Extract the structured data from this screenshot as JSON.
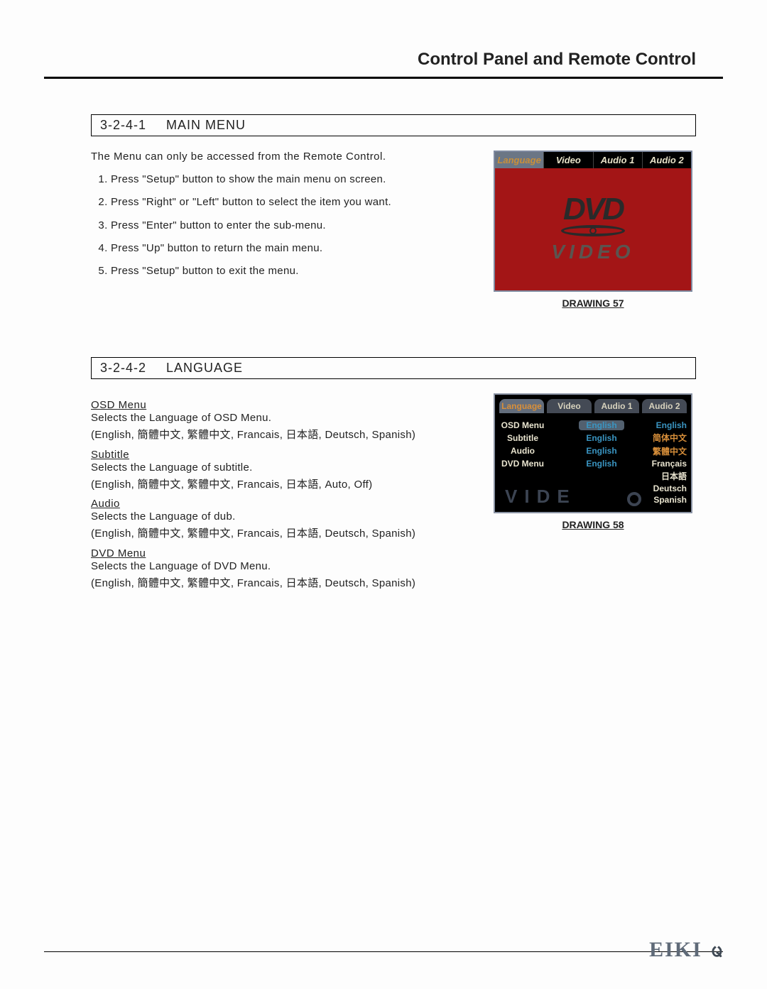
{
  "header": {
    "title": "Control Panel and Remote Control"
  },
  "section1": {
    "num": "3-2-4-1",
    "title": "MAIN MENU",
    "intro": "The Menu can only be accessed from the Remote Control.",
    "steps": [
      "Press \"Setup\" button to show the main menu on screen.",
      "Press \"Right\" or \"Left\" button to select the item you want.",
      "Press \"Enter\" button to enter the sub-menu.",
      "Press \"Up\" button to return the main menu.",
      "Press \"Setup\" button to exit the menu."
    ],
    "figure": {
      "tabs": [
        "Language",
        "Video",
        "Audio 1",
        "Audio 2"
      ],
      "logo_top": "DVD",
      "logo_bottom": "VIDEO",
      "caption": "DRAWING 57"
    }
  },
  "section2": {
    "num": "3-2-4-2",
    "title": "LANGUAGE",
    "items": [
      {
        "h": "OSD Menu",
        "d1": "Selects the Language of OSD Menu.",
        "d2": "(English, 簡體中文, 繁體中文, Francais, 日本語, Deutsch, Spanish)"
      },
      {
        "h": "Subtitle",
        "d1": "Selects the Language of subtitle.",
        "d2": "(English, 簡體中文, 繁體中文, Francais, 日本語, Auto, Off)"
      },
      {
        "h": "Audio",
        "d1": "Selects the Language of dub.",
        "d2": "(English, 簡體中文, 繁體中文, Francais, 日本語, Deutsch, Spanish)"
      },
      {
        "h": "DVD Menu",
        "d1": "Selects the Language of DVD Menu.",
        "d2": "(English, 簡體中文, 繁體中文, Francais, 日本語, Deutsch, Spanish)"
      }
    ],
    "figure": {
      "tabs": [
        "Language",
        "Video",
        "Audio 1",
        "Audio 2"
      ],
      "rows": {
        "labels": [
          "OSD Menu",
          "Subtitle",
          "Audio",
          "DVD Menu"
        ],
        "values": [
          "English",
          "English",
          "English",
          "English"
        ]
      },
      "options": [
        "English",
        "简体中文",
        "繁體中文",
        "Français",
        "日本語",
        "Deutsch",
        "Spanish"
      ],
      "ghost": "VIDE",
      "caption": "DRAWING 58"
    }
  },
  "footer": {
    "brand": "EIKI",
    "page": "ᨾ"
  }
}
